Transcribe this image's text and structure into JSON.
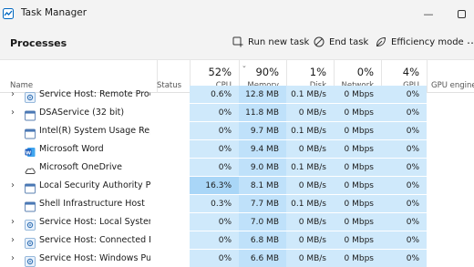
{
  "window": {
    "title": "Task Manager"
  },
  "toolbar": {
    "page_title": "Processes",
    "run_new_task": "Run new task",
    "end_task": "End task",
    "efficiency_mode": "Efficiency mode"
  },
  "columns": {
    "name": "Name",
    "status": "Status",
    "cpu": {
      "label": "CPU",
      "total": "52%"
    },
    "memory": {
      "label": "Memory",
      "total": "90%"
    },
    "disk": {
      "label": "Disk",
      "total": "1%"
    },
    "network": {
      "label": "Network",
      "total": "0%"
    },
    "gpu": {
      "label": "GPU",
      "total": "4%"
    },
    "gpu_engine": "GPU engine"
  },
  "colors": {
    "heat_low": "#cfe9fb",
    "heat_cpu_high": "#a9d6f7",
    "heat_mem": "#bfe1fa",
    "accent": "#0067c0"
  },
  "processes": [
    {
      "name": "Service Host: Remote Procedu...",
      "icon": "gear-icon",
      "expandable": true,
      "cpu": "0.6%",
      "memory": "12.8 MB",
      "disk": "0.1 MB/s",
      "network": "0 Mbps",
      "gpu": "0%"
    },
    {
      "name": "DSAService (32 bit)",
      "icon": "app-window-icon",
      "expandable": true,
      "cpu": "0%",
      "memory": "11.8 MB",
      "disk": "0 MB/s",
      "network": "0 Mbps",
      "gpu": "0%"
    },
    {
      "name": "Intel(R) System Usage Report",
      "icon": "app-window-icon",
      "expandable": false,
      "cpu": "0%",
      "memory": "9.7 MB",
      "disk": "0.1 MB/s",
      "network": "0 Mbps",
      "gpu": "0%"
    },
    {
      "name": "Microsoft Word",
      "icon": "word-icon",
      "expandable": false,
      "cpu": "0%",
      "memory": "9.4 MB",
      "disk": "0 MB/s",
      "network": "0 Mbps",
      "gpu": "0%"
    },
    {
      "name": "Microsoft OneDrive",
      "icon": "onedrive-icon",
      "expandable": false,
      "cpu": "0%",
      "memory": "9.0 MB",
      "disk": "0.1 MB/s",
      "network": "0 Mbps",
      "gpu": "0%"
    },
    {
      "name": "Local Security Authority Proce...",
      "icon": "app-window-icon",
      "expandable": true,
      "cpu": "16.3%",
      "memory": "8.1 MB",
      "disk": "0 MB/s",
      "network": "0 Mbps",
      "gpu": "0%"
    },
    {
      "name": "Shell Infrastructure Host",
      "icon": "app-window-icon",
      "expandable": false,
      "cpu": "0.3%",
      "memory": "7.7 MB",
      "disk": "0.1 MB/s",
      "network": "0 Mbps",
      "gpu": "0%"
    },
    {
      "name": "Service Host: Local System",
      "icon": "gear-icon",
      "expandable": true,
      "cpu": "0%",
      "memory": "7.0 MB",
      "disk": "0 MB/s",
      "network": "0 Mbps",
      "gpu": "0%"
    },
    {
      "name": "Service Host: Connected Devic...",
      "icon": "gear-icon",
      "expandable": true,
      "cpu": "0%",
      "memory": "6.8 MB",
      "disk": "0 MB/s",
      "network": "0 Mbps",
      "gpu": "0%"
    },
    {
      "name": "Service Host: Windows Push N...",
      "icon": "gear-icon",
      "expandable": true,
      "cpu": "0%",
      "memory": "6.6 MB",
      "disk": "0 MB/s",
      "network": "0 Mbps",
      "gpu": "0%"
    }
  ]
}
